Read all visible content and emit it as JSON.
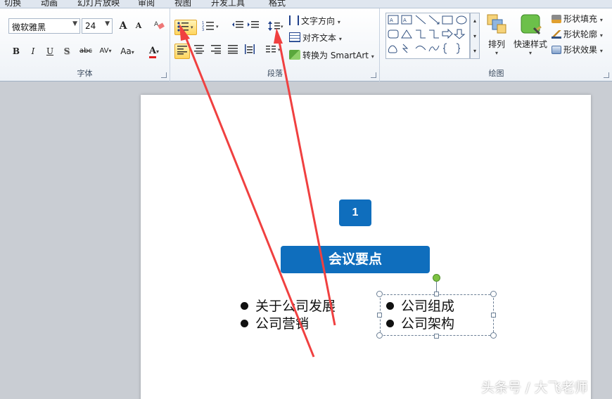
{
  "tabs": [
    "切换",
    "动画",
    "幻灯片放映",
    "审阅",
    "视图",
    "开发工具",
    "格式"
  ],
  "font_group": {
    "font_name": "微软雅黑",
    "font_size": "24",
    "grow_label": "A",
    "shrink_label": "A",
    "bold": "B",
    "italic": "I",
    "underline": "U",
    "shadow": "S",
    "strike": "abc",
    "spacing": "AV",
    "case": "Aa",
    "color": "A",
    "label": "字体"
  },
  "paragraph_group": {
    "text_direction": "文字方向",
    "align_text": "对齐文本",
    "convert_smartart": "转换为 SmartArt",
    "label": "段落"
  },
  "drawing_group": {
    "arrange": "排列",
    "quick_styles": "快速样式",
    "shape_fill": "形状填充",
    "shape_outline": "形状轮廓",
    "shape_effects": "形状效果",
    "label": "绘图"
  },
  "slide": {
    "number": "1",
    "title": "会议要点",
    "left_list": [
      "关于公司发展",
      "公司营销"
    ],
    "right_list": [
      "公司组成",
      "公司架构"
    ]
  },
  "watermark": "头条号 / 大飞老师",
  "colors": {
    "accent_blue": "#0f6ebd",
    "arrow_red": "#f04040",
    "rotate_green": "#7dc242"
  }
}
